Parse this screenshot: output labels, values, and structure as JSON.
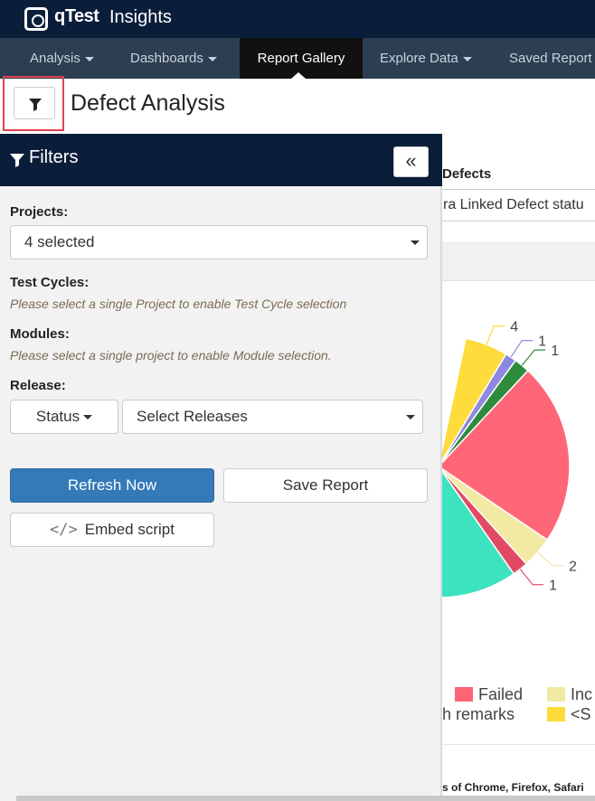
{
  "brand": {
    "name": "qTest",
    "product": "Insights"
  },
  "nav": {
    "items": [
      {
        "label": "Analysis",
        "dropdown": true
      },
      {
        "label": "Dashboards",
        "dropdown": true
      },
      {
        "label": "Report Gallery",
        "active": true
      },
      {
        "label": "Explore Data",
        "dropdown": true
      },
      {
        "label": "Saved Report",
        "dropdown": false
      }
    ]
  },
  "header": {
    "title": "Defect Analysis",
    "filter_icon": "filter-icon"
  },
  "filters": {
    "title": "Filters",
    "collapse_icon": "«",
    "projects": {
      "label": "Projects:",
      "value": "4 selected"
    },
    "test_cycles": {
      "label": "Test Cycles:",
      "hint": "Please select a single Project to enable Test Cycle selection"
    },
    "modules": {
      "label": "Modules:",
      "hint": "Please select a single project to enable Module selection."
    },
    "release": {
      "label": "Release:",
      "status_label": "Status",
      "value": "Select Releases"
    },
    "refresh_label": "Refresh Now",
    "save_label": "Save Report",
    "embed_label": "Embed script",
    "embed_icon": "</>"
  },
  "report": {
    "defects_label": "Defects",
    "defects_select_value": "ra Linked Defect statu",
    "footer_note": "s of Chrome, Firefox, Safari"
  },
  "colors": {
    "brand_dark": "#0a1e3a",
    "nav_bg": "#2c3e52",
    "primary": "#337ab7",
    "highlight": "#e0424f"
  },
  "chart_data": {
    "type": "pie",
    "slices": [
      {
        "label": "4",
        "color": "#fddc3b"
      },
      {
        "label": "1",
        "color": "#8e88e0"
      },
      {
        "label": "1",
        "color": "#2e8b3e"
      },
      {
        "label": "",
        "color": "#ff6677"
      },
      {
        "label": "2",
        "color": "#f2e9a2"
      },
      {
        "label": "1",
        "color": "#e24a64"
      },
      {
        "label": "",
        "color": "#3de3be"
      }
    ],
    "legend": [
      {
        "name": "Failed",
        "color": "#ff6677"
      },
      {
        "name": "Inc",
        "color": "#f2e9a2"
      },
      {
        "name": "h remarks",
        "color": ""
      },
      {
        "name": "<S",
        "color": "#fddc3b"
      }
    ]
  }
}
